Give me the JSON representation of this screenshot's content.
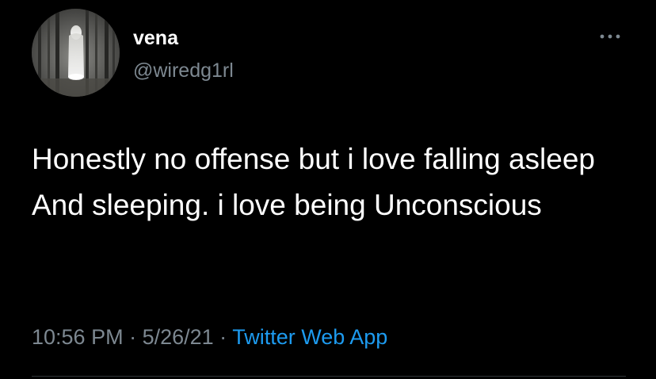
{
  "author": {
    "display_name": "vena",
    "handle": "@wiredg1rl",
    "avatar_icon": "ghostly-figure-in-forest-avatar"
  },
  "tweet": {
    "text": "Honestly no offense but i love falling asleep And sleeping. i love being Unconscious"
  },
  "meta": {
    "time": "10:56 PM",
    "separator_1": " · ",
    "date": "5/26/21",
    "separator_2": " · ",
    "source": "Twitter Web App"
  },
  "icons": {
    "more": "more-options-icon"
  },
  "colors": {
    "background": "#000000",
    "text": "#ffffff",
    "secondary_text": "#7d8891",
    "link": "#1d9bf0",
    "divider": "#2f3336"
  }
}
